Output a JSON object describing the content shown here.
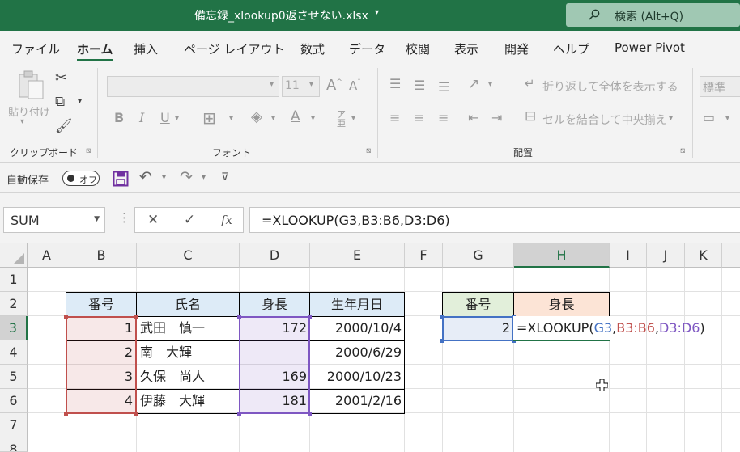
{
  "titlebar": {
    "title": "備忘録_xlookup0返させない.xlsx",
    "search_label": "検索 (Alt+Q)"
  },
  "menu": {
    "tabs": [
      "ファイル",
      "ホーム",
      "挿入",
      "ページ レイアウト",
      "数式",
      "データ",
      "校閲",
      "表示",
      "開発",
      "ヘルプ",
      "Power Pivot"
    ],
    "active": "ホーム"
  },
  "ribbon": {
    "paste": "貼り付け",
    "clipboard": "クリップボード",
    "font_group": "フォント",
    "font_size": "11",
    "align_group": "配置",
    "wrap_text": "折り返して全体を表示する",
    "merge_center": "セルを結合して中央揃え",
    "number_format": "標準"
  },
  "qat": {
    "autosave_label": "自動保存",
    "autosave_state": "オフ"
  },
  "formula_bar": {
    "name_box": "SUM",
    "formula": "=XLOOKUP(G3,B3:B6,D3:D6)"
  },
  "grid": {
    "columns": [
      "A",
      "B",
      "C",
      "D",
      "E",
      "F",
      "G",
      "H",
      "I",
      "J",
      "K"
    ],
    "rows": [
      "1",
      "2",
      "3",
      "4",
      "5",
      "6",
      "7",
      "8"
    ],
    "table_headers": [
      "番号",
      "氏名",
      "身長",
      "生年月日"
    ],
    "table_rows": [
      {
        "num": "1",
        "name": "武田　慎一",
        "height": "172",
        "birth": "2000/10/4"
      },
      {
        "num": "2",
        "name": "南　大輝",
        "height": "",
        "birth": "2000/6/29"
      },
      {
        "num": "3",
        "name": "久保　尚人",
        "height": "169",
        "birth": "2000/10/23"
      },
      {
        "num": "4",
        "name": "伊藤　大輝",
        "height": "181",
        "birth": "2001/2/16"
      }
    ],
    "lookup_headers": [
      "番号",
      "身長"
    ],
    "lookup_value": "2",
    "editing_formula": {
      "prefix": "=XLOOKUP(",
      "ref1": "G3",
      "sep1": ",",
      "ref2": "B3:B6",
      "sep2": ",",
      "ref3": "D3:D6",
      "suffix": ")"
    }
  },
  "colors": {
    "brand": "#217346",
    "ref_blue": "#4472c4",
    "ref_red": "#c0504d",
    "ref_purple": "#7e57c2"
  }
}
